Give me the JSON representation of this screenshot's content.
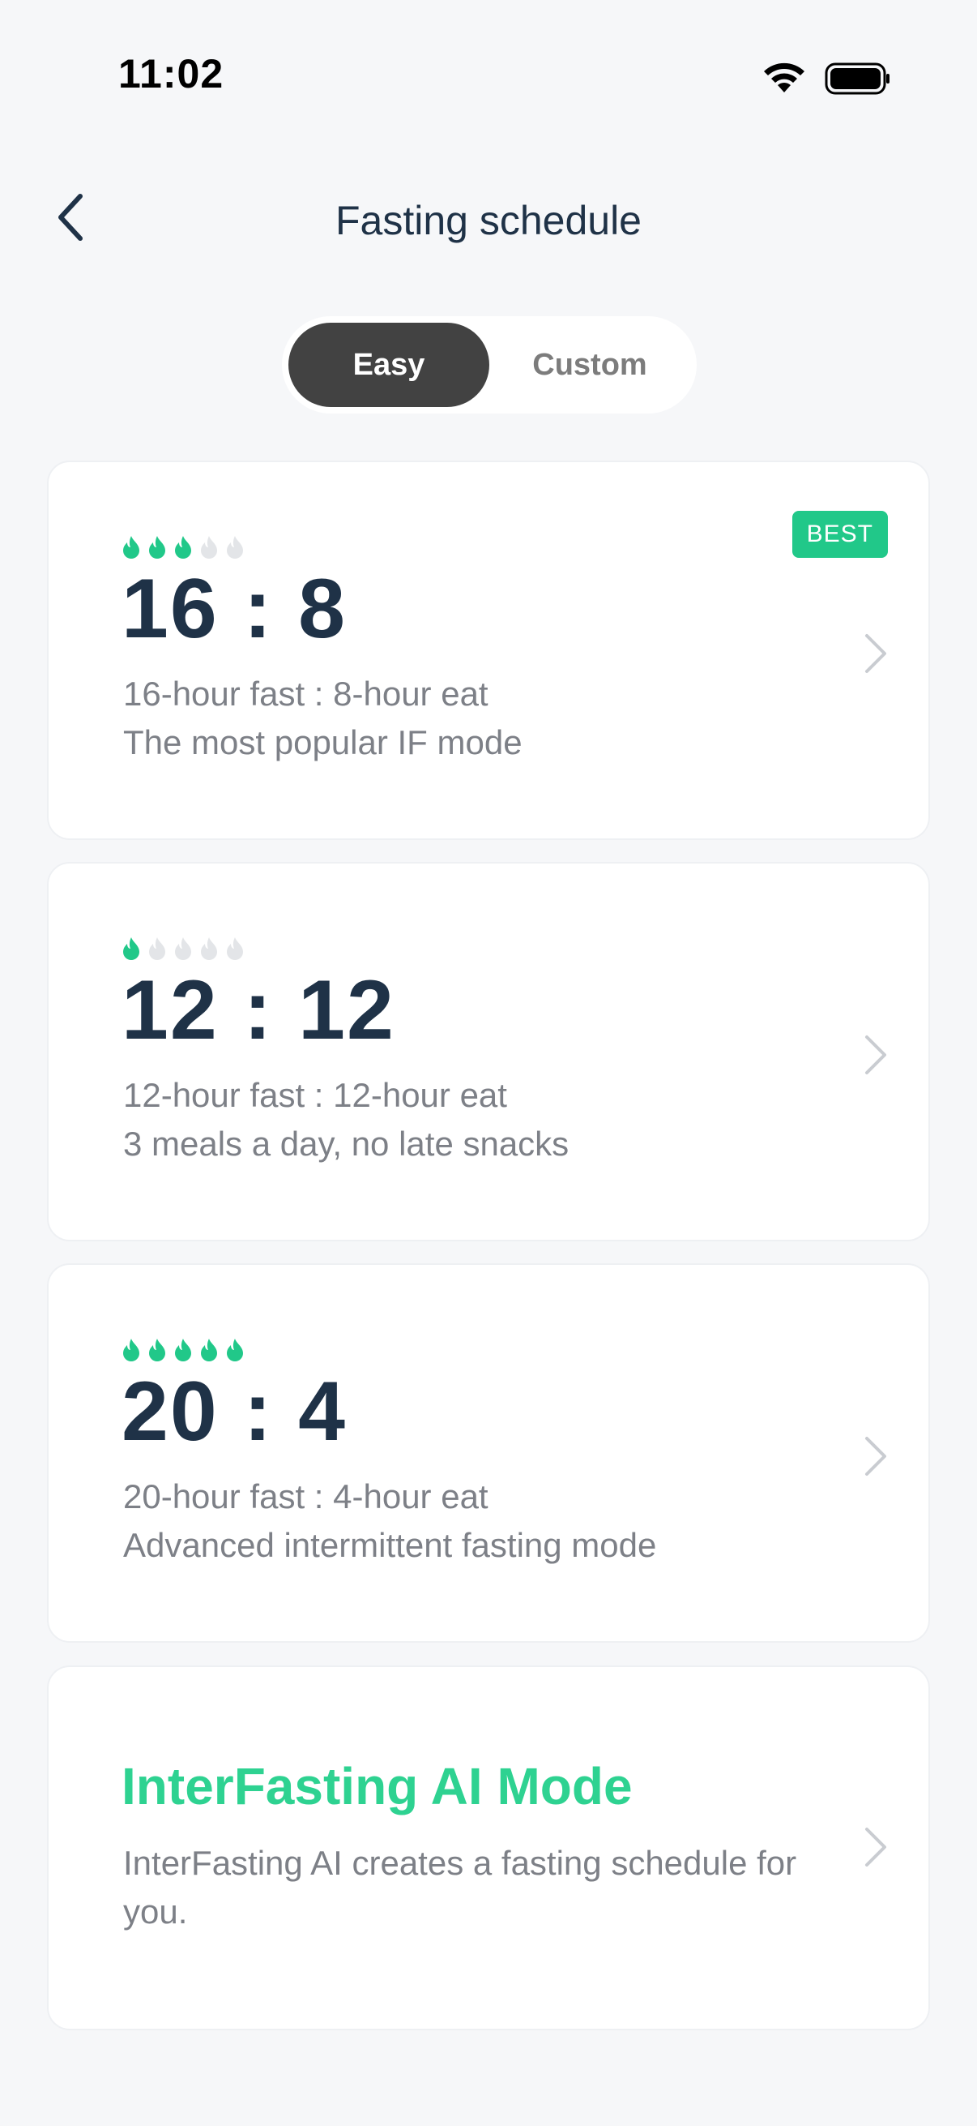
{
  "status": {
    "time": "11:02"
  },
  "nav": {
    "title": "Fasting schedule"
  },
  "tabs": [
    {
      "label": "Easy",
      "active": true
    },
    {
      "label": "Custom",
      "active": false
    }
  ],
  "colors": {
    "accent": "#21c889",
    "flame_on": "#21c889",
    "flame_off": "#e3e5e8",
    "title": "#1f3247",
    "muted": "#7d8087"
  },
  "plans": [
    {
      "ratio": "16 : 8",
      "line1": "16-hour fast : 8-hour eat",
      "line2": "The most popular IF mode",
      "difficulty": 3,
      "badge": "BEST"
    },
    {
      "ratio": "12 : 12",
      "line1": "12-hour fast : 12-hour eat",
      "line2": "3 meals a day, no late snacks",
      "difficulty": 1
    },
    {
      "ratio": "20 : 4",
      "line1": "20-hour fast : 4-hour eat",
      "line2": "Advanced intermittent fasting mode",
      "difficulty": 5
    }
  ],
  "ai_mode": {
    "title": "InterFasting AI Mode",
    "description": "InterFasting AI creates a fasting schedule for you."
  }
}
